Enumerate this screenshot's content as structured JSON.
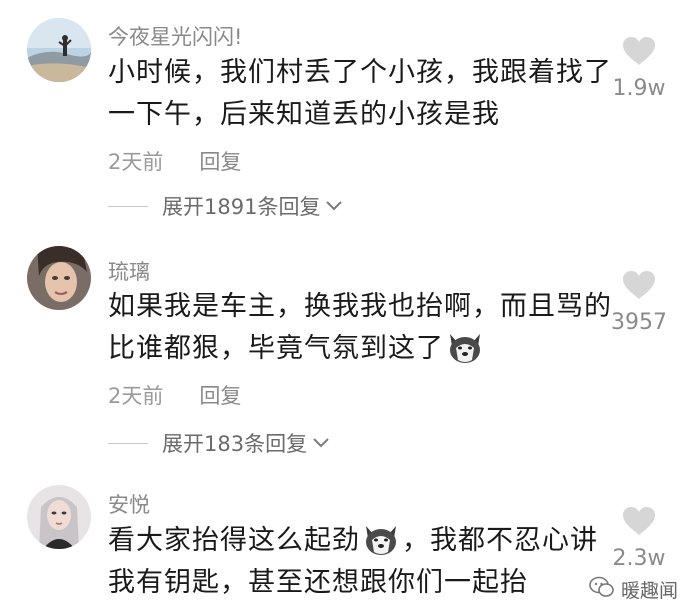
{
  "comments": [
    {
      "username": "今夜星光闪闪!",
      "text": "小时候，我们村丢了个小孩，我跟着找了一下午，后来知道丢的小孩是我",
      "time": "2天前",
      "reply_label": "回复",
      "expand_label": "展开1891条回复",
      "likes": "1.9w"
    },
    {
      "username": "琉璃",
      "text_before_emoji": "如果我是车主，换我我也抬啊，而且骂的比谁都狠，毕竟气氛到这了",
      "time": "2天前",
      "reply_label": "回复",
      "expand_label": "展开183条回复",
      "likes": "3957"
    },
    {
      "username": "安悦",
      "text_before_emoji": "看大家抬得这么起劲",
      "text_after_emoji": "，我都不忍心讲我有钥匙，甚至还想跟你们一起抬",
      "likes": "2.3w"
    }
  ],
  "watermark": "暖趣闻",
  "icons": {
    "like": "heart-icon",
    "expand": "chevron-down-icon",
    "emoji": "husky-dog-emoji",
    "watermark": "wechat-icon"
  },
  "colors": {
    "username": "#8a8a8a",
    "text": "#1a1a1a",
    "heart": "#d6d6d6"
  }
}
